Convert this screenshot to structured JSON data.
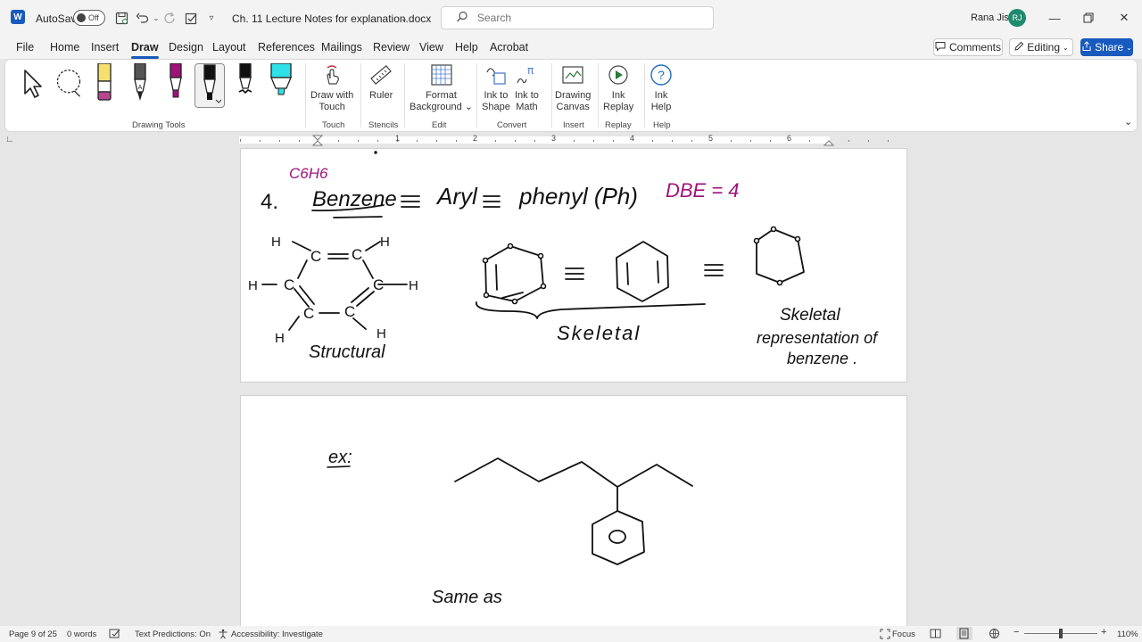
{
  "app": {
    "autosave_label": "AutoSave",
    "autosave_state": "Off",
    "doc_title": "Ch. 11 Lecture Notes for explanation.docx",
    "search_placeholder": "Search",
    "user_name": "Rana Jisr",
    "user_initials": "RJ"
  },
  "menu": {
    "tabs": [
      "File",
      "Home",
      "Insert",
      "Draw",
      "Design",
      "Layout",
      "References",
      "Mailings",
      "Review",
      "View",
      "Help",
      "Acrobat"
    ],
    "active": "Draw",
    "comments_label": "Comments",
    "editing_label": "Editing",
    "share_label": "Share"
  },
  "ribbon": {
    "groups": {
      "drawing_tools": "Drawing Tools",
      "touch": "Touch",
      "stencils": "Stencils",
      "edit": "Edit",
      "convert": "Convert",
      "insert": "Insert",
      "replay": "Replay",
      "help": "Help"
    },
    "draw_with_touch": [
      "Draw with",
      "Touch"
    ],
    "ruler": "Ruler",
    "format_background": [
      "Format",
      "Background"
    ],
    "ink_to_shape": [
      "Ink to",
      "Shape"
    ],
    "ink_to_math": [
      "Ink to",
      "Math"
    ],
    "drawing_canvas": [
      "Drawing",
      "Canvas"
    ],
    "ink_replay": [
      "Ink",
      "Replay"
    ],
    "ink_help": [
      "Ink",
      "Help"
    ],
    "pen_colors": {
      "highlighter_yellow": "#f5e06e",
      "highlighter_purple": "#b6478f",
      "pen_magenta": "#a0127a",
      "pen_black": "#111111",
      "highlighter_cyan": "#2ee0e8"
    }
  },
  "ruler": {
    "numbers": [
      "1",
      "2",
      "3",
      "4",
      "5",
      "6"
    ]
  },
  "page1": {
    "formula": "C6H6",
    "item_number": "4.",
    "heading_benzene": "Benzene",
    "equiv_aryl": "Aryl",
    "equiv_phenyl": "phenyl (Ph)",
    "dbe": "DBE = 4",
    "label_structural": "Structural",
    "label_skeletal": "Skeletal",
    "label_skeletal_rep": [
      "Skeletal",
      "representation of",
      "benzene ."
    ],
    "atom_c": "C",
    "atom_h": "H",
    "ink_color_magenta": "#a0127a"
  },
  "page2": {
    "ex_label": "ex:",
    "same_as": "Same as"
  },
  "status": {
    "page": "Page 9 of 25",
    "words": "0 words",
    "text_predictions": "Text Predictions: On",
    "accessibility": "Accessibility: Investigate",
    "focus": "Focus",
    "zoom": "110%"
  }
}
